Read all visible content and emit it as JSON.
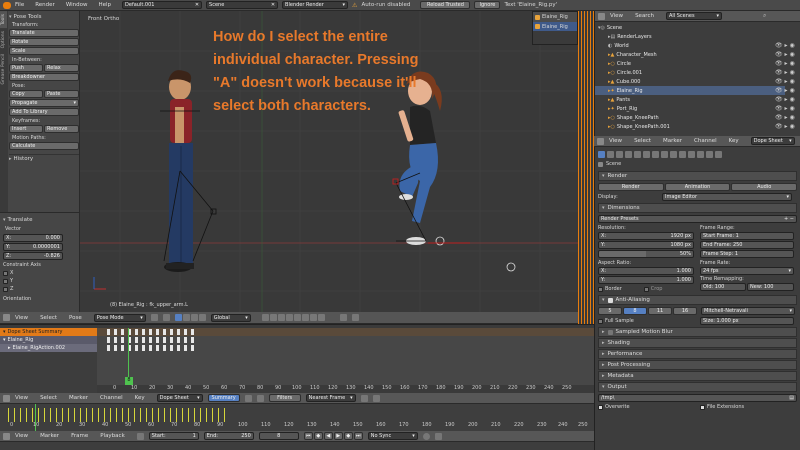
{
  "top_bar": {
    "menus": [
      "File",
      "Render",
      "Window",
      "Help"
    ],
    "layout": "Default.001",
    "scene": "Scene",
    "engine": "Blender Render",
    "autorun": "Auto-run disabled",
    "reload_trusted": "Reload Trusted",
    "ignore": "Ignore",
    "text_label": "Text 'Elaine_Rig.py'"
  },
  "tool_shelf": {
    "title": "Pose Tools",
    "tabs": [
      "Tools",
      "Options",
      "Grease Pencil"
    ],
    "transform_label": "Transform:",
    "transform_buttons": [
      "Translate",
      "Rotate",
      "Scale"
    ],
    "inbetween_label": "In-Between:",
    "push": "Push",
    "relax": "Relax",
    "breakdowner": "Breakdowner",
    "pose_label": "Pose:",
    "copy": "Copy",
    "paste": "Paste",
    "propagate": "Propagate",
    "add_to_library": "Add To Library",
    "keyframes_label": "Keyframes:",
    "insert": "Insert",
    "remove": "Remove",
    "motion_paths_label": "Motion Paths:",
    "calculate": "Calculate",
    "history": "History"
  },
  "operator_panel": {
    "title": "Translate",
    "vector_label": "Vector",
    "x_label": "X:",
    "x": "0.000",
    "y_label": "Y:",
    "y": "0.0000001",
    "z_label": "Z:",
    "z": "-0.826",
    "constraint_label": "Constraint Axis",
    "axes": [
      "X",
      "Y",
      "Z"
    ],
    "orientation": "Orientation"
  },
  "viewport": {
    "view_name": "Front Ortho",
    "status": "(8) Elaine_Rig : fk_upper_arm.L",
    "question": "How do I select the entire individual character. Pressing \"A\" doesn't work because it'll select both characters.",
    "annotation_color": "#e8792b",
    "header": {
      "menus": [
        "View",
        "Select",
        "Pose"
      ],
      "mode": "Pose Mode",
      "orientation": "Global"
    }
  },
  "outliner": {
    "menus": [
      "View",
      "Search"
    ],
    "filter": "All Scenes",
    "items": [
      "Scene",
      "RenderLayers",
      "World",
      "Character_Mesh",
      "Circle",
      "Circle.001",
      "Cube.000",
      "Elaine_Rig",
      "Pants",
      "Port_Rig",
      "Shape_KneePath",
      "Shape_KneePath.001"
    ]
  },
  "elaine_window": {
    "items": [
      "Elaine_Rig",
      "Elaine_Rig"
    ]
  },
  "dopesheet_header": {
    "menus": [
      "View",
      "Select",
      "Marker",
      "Channel",
      "Key"
    ],
    "mode": "Dope Sheet"
  },
  "properties": {
    "scene_label": "Scene",
    "render_label": "Render",
    "render_buttons": [
      "Render",
      "Animation",
      "Audio"
    ],
    "display_label": "Display:",
    "display_value": "Image Editor",
    "dimensions_label": "Dimensions",
    "render_presets": "Render Presets",
    "resolution_label": "Resolution:",
    "res_x": "1920 px",
    "res_y": "1080 px",
    "res_pct": "50%",
    "aspect_label": "Aspect Ratio:",
    "asp_x": "1.000",
    "asp_y": "1.000",
    "border": "Border",
    "crop": "Crop",
    "frame_range_label": "Frame Range:",
    "start_frame": "Start Frame: 1",
    "end_frame": "End Frame: 250",
    "frame_step": "Frame Step: 1",
    "frame_rate_label": "Frame Rate:",
    "fps": "24 fps",
    "time_remap_label": "Time Remapping:",
    "old": "Old: 100",
    "new": "New: 100",
    "aa_label": "Anti-Aliasing",
    "aa_samples": [
      "5",
      "8",
      "11",
      "16"
    ],
    "aa_filter": "Mitchell-Netravali",
    "full_sample": "Full Sample",
    "size": "Size: 1.000 px",
    "sections": [
      "Sampled Motion Blur",
      "Shading",
      "Performance",
      "Post Processing",
      "Metadata",
      "Output"
    ],
    "output_path": "/tmp\\",
    "overwrite": "Overwrite",
    "file_extensions": "File Extensions"
  },
  "dopesheet": {
    "channels": [
      "Dope Sheet Summary",
      "Elaine_Rig",
      "Elaine_RigAction.002"
    ],
    "ticks": [
      "0",
      "10",
      "20",
      "30",
      "40",
      "50",
      "60",
      "70",
      "80",
      "90",
      "100",
      "110",
      "120",
      "130",
      "140",
      "150",
      "160",
      "170",
      "180",
      "190",
      "200",
      "210",
      "220",
      "230",
      "240",
      "250"
    ],
    "current_frame": "8",
    "header": {
      "menus": [
        "View",
        "Select",
        "Marker",
        "Channel",
        "Key"
      ],
      "mode": "Dope Sheet",
      "summary": "Summary",
      "filters": "Filters",
      "snap": "Nearest Frame"
    }
  },
  "timeline": {
    "ticks": [
      "0",
      "10",
      "20",
      "30",
      "40",
      "50",
      "60",
      "70",
      "80",
      "90",
      "100",
      "110",
      "120",
      "130",
      "140",
      "150",
      "160",
      "170",
      "180",
      "190",
      "200",
      "210",
      "220",
      "230",
      "240",
      "250"
    ],
    "header": {
      "menus": [
        "View",
        "Marker",
        "Frame",
        "Playback"
      ],
      "start": "Start:",
      "start_val": "1",
      "end": "End:",
      "end_val": "250",
      "frame": "8",
      "sync": "No Sync"
    }
  }
}
